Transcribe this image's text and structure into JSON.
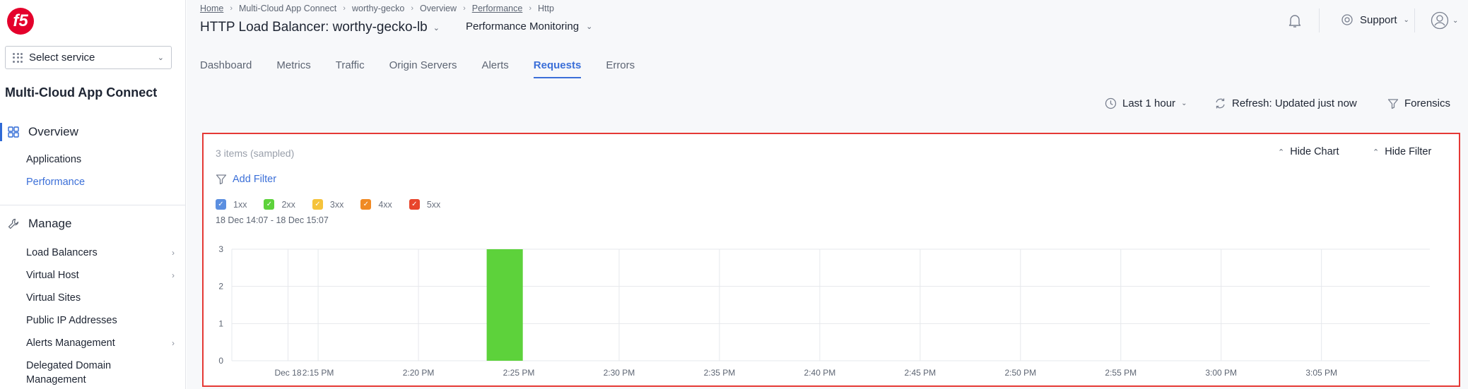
{
  "sidebar": {
    "logo": "f5",
    "select_service": "Select service",
    "app_title": "Multi-Cloud App Connect",
    "overview": {
      "label": "Overview",
      "items": [
        {
          "label": "Applications"
        },
        {
          "label": "Performance"
        }
      ]
    },
    "manage": {
      "label": "Manage",
      "items": [
        {
          "label": "Load Balancers"
        },
        {
          "label": "Virtual Host"
        },
        {
          "label": "Virtual Sites"
        },
        {
          "label": "Public IP Addresses"
        },
        {
          "label": "Alerts Management"
        },
        {
          "label": "Delegated Domain"
        },
        {
          "label": "Management"
        }
      ]
    }
  },
  "breadcrumb": [
    "Home",
    "Multi-Cloud App Connect",
    "worthy-gecko",
    "Overview",
    "Performance",
    "Http"
  ],
  "page_title": "HTTP Load Balancer: worthy-gecko-lb",
  "perf_dropdown": "Performance Monitoring",
  "header": {
    "support": "Support"
  },
  "tabs": [
    "Dashboard",
    "Metrics",
    "Traffic",
    "Origin Servers",
    "Alerts",
    "Requests",
    "Errors"
  ],
  "active_tab": "Requests",
  "toolbar": {
    "time_range": "Last 1 hour",
    "refresh": "Refresh: Updated just now",
    "forensics": "Forensics"
  },
  "panel": {
    "items_count": "3 items (sampled)",
    "hide_chart": "Hide Chart",
    "hide_filter": "Hide Filter",
    "add_filter": "Add Filter",
    "legend": [
      {
        "label": "1xx",
        "color": "#5b8fe0"
      },
      {
        "label": "2xx",
        "color": "#5dd23b"
      },
      {
        "label": "3xx",
        "color": "#f5c33b"
      },
      {
        "label": "4xx",
        "color": "#f08a24"
      },
      {
        "label": "5xx",
        "color": "#e8452c"
      }
    ],
    "date_range": "18 Dec 14:07 - 18 Dec 15:07"
  },
  "chart_data": {
    "type": "bar",
    "x_ticks": [
      "Dec 18",
      "2:15 PM",
      "2:20 PM",
      "2:25 PM",
      "2:30 PM",
      "2:35 PM",
      "2:40 PM",
      "2:45 PM",
      "2:50 PM",
      "2:55 PM",
      "3:00 PM",
      "3:05 PM"
    ],
    "x_tick_minutes": [
      13.5,
      15,
      20,
      25,
      30,
      35,
      40,
      45,
      50,
      55,
      60,
      65
    ],
    "x_range_minutes": [
      10.7,
      70.4
    ],
    "y_ticks": [
      0,
      1,
      2,
      3
    ],
    "ylim": [
      0,
      3
    ],
    "grid": true,
    "series": [
      {
        "name": "2xx",
        "color": "#5dd23b",
        "bars": [
          {
            "start_minute": 23.4,
            "end_minute": 25.2,
            "value": 3
          }
        ]
      }
    ]
  }
}
